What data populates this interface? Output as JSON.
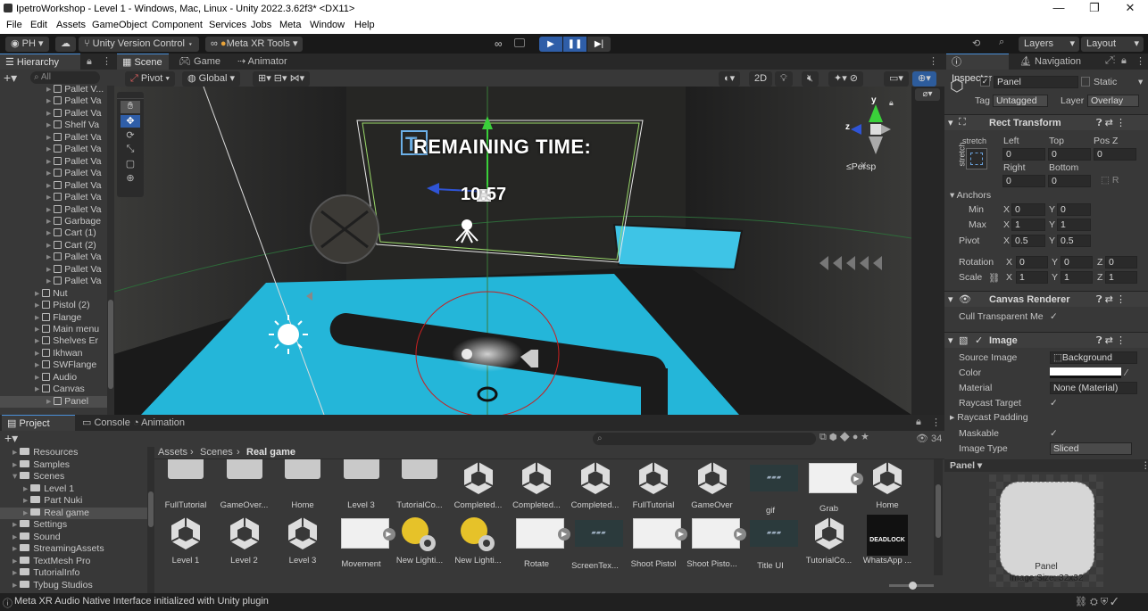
{
  "window": {
    "title": "IpetroWorkshop - Level 1 - Windows, Mac, Linux - Unity 2022.3.62f3* <DX11>",
    "min": "—",
    "max": "❐",
    "close": "✕"
  },
  "menu": [
    "File",
    "Edit",
    "Assets",
    "GameObject",
    "Component",
    "Services",
    "Jobs",
    "Meta",
    "Window",
    "Help"
  ],
  "toolbar": {
    "account": "PH ▾",
    "cloud": "☁",
    "vcs": "Unity Version Control ▾",
    "metaxr": "Meta XR Tools ▾",
    "layers": "Layers",
    "layout": "Layout"
  },
  "hierarchy": {
    "title": "Hierarchy",
    "search": "All",
    "items": [
      {
        "label": "Pallet V...",
        "indent": 4
      },
      {
        "label": "Pallet Va",
        "indent": 4
      },
      {
        "label": "Pallet Va",
        "indent": 4
      },
      {
        "label": "Shelf Va",
        "indent": 4
      },
      {
        "label": "Pallet Va",
        "indent": 4
      },
      {
        "label": "Pallet Va",
        "indent": 4
      },
      {
        "label": "Pallet Va",
        "indent": 4
      },
      {
        "label": "Pallet Va",
        "indent": 4
      },
      {
        "label": "Pallet Va",
        "indent": 4
      },
      {
        "label": "Pallet Va",
        "indent": 4
      },
      {
        "label": "Pallet Va",
        "indent": 4
      },
      {
        "label": "Garbage",
        "indent": 4
      },
      {
        "label": "Cart (1)",
        "indent": 4
      },
      {
        "label": "Cart (2)",
        "indent": 4
      },
      {
        "label": "Pallet Va",
        "indent": 4
      },
      {
        "label": "Pallet Va",
        "indent": 4
      },
      {
        "label": "Pallet Va",
        "indent": 4
      },
      {
        "label": "Nut",
        "indent": 3
      },
      {
        "label": "Pistol (2)",
        "indent": 3
      },
      {
        "label": "Flange",
        "indent": 3
      },
      {
        "label": "Main menu",
        "indent": 3
      },
      {
        "label": "Shelves Er",
        "indent": 3
      },
      {
        "label": "Ikhwan",
        "indent": 3
      },
      {
        "label": "SWFlange",
        "indent": 3
      },
      {
        "label": "Audio",
        "indent": 3
      },
      {
        "label": "Canvas",
        "indent": 3
      },
      {
        "label": "Panel",
        "indent": 4
      }
    ]
  },
  "scene": {
    "tabs": [
      "Scene",
      "Game",
      "Animator"
    ],
    "pivot": "Pivot ▾",
    "global": "Global ▾",
    "mode2d": "2D",
    "persp": "≤Persp",
    "hud_title": "REMAINING TIME:",
    "hud_time": "10:57",
    "axis_y": "y",
    "axis_z": "z"
  },
  "inspector": {
    "tabs": [
      "Inspector",
      "Navigation"
    ],
    "object": "Panel",
    "static": "Static",
    "tag_label": "Tag",
    "tag": "Untagged",
    "layer_label": "Layer",
    "layer": "Overlay",
    "rect": {
      "title": "Rect Transform",
      "stretch": "stretch",
      "left": "Left",
      "top": "Top",
      "posz": "Pos Z",
      "v_left": "0",
      "v_top": "0",
      "v_posz": "0",
      "right": "Right",
      "bottom": "Bottom",
      "v_right": "0",
      "v_bottom": "0",
      "anchors": "Anchors",
      "min": "Min",
      "max": "Max",
      "pivot": "Pivot",
      "min_x": "0",
      "min_y": "0",
      "max_x": "1",
      "max_y": "1",
      "piv_x": "0.5",
      "piv_y": "0.5",
      "rotation": "Rotation",
      "rx": "0",
      "ry": "0",
      "rz": "0",
      "scale": "Scale",
      "sx": "1",
      "sy": "1",
      "sz": "1"
    },
    "canvas_renderer": {
      "title": "Canvas Renderer",
      "cull": "Cull Transparent Me"
    },
    "image": {
      "title": "Image",
      "source_label": "Source Image",
      "source": "Background",
      "color_label": "Color",
      "material_label": "Material",
      "material": "None (Material)",
      "raycast_target": "Raycast Target",
      "raycast_padding": "Raycast Padding",
      "maskable": "Maskable",
      "image_type_label": "Image Type",
      "image_type": "Sliced"
    },
    "preview": {
      "title": "Panel ▾",
      "label": "Panel",
      "size": "Image Size: 32x32"
    }
  },
  "project": {
    "tabs": [
      "Project",
      "Console",
      "Animation"
    ],
    "count": "34",
    "breadcrumb": [
      "Assets",
      "Scenes",
      "Real game"
    ],
    "tree": [
      {
        "label": "Resources",
        "indent": 1
      },
      {
        "label": "Samples",
        "indent": 1
      },
      {
        "label": "Scenes",
        "indent": 1
      },
      {
        "label": "Level 1",
        "indent": 2
      },
      {
        "label": "Part Nuki",
        "indent": 2
      },
      {
        "label": "Real game",
        "indent": 2
      },
      {
        "label": "Settings",
        "indent": 1
      },
      {
        "label": "Sound",
        "indent": 1
      },
      {
        "label": "StreamingAssets",
        "indent": 1
      },
      {
        "label": "TextMesh Pro",
        "indent": 1
      },
      {
        "label": "TutorialInfo",
        "indent": 1
      },
      {
        "label": "Tybug Studios",
        "indent": 1
      }
    ],
    "row1": [
      "FullTutorial",
      "GameOver...",
      "Home",
      "Level 3",
      "TutorialCo...",
      "Completed...",
      "Completed...",
      "Completed...",
      "FullTutorial",
      "GameOver",
      "gif",
      "Grab",
      "Home"
    ],
    "row2": [
      "Level 1",
      "Level 2",
      "Level 3",
      "Movement",
      "New Lighti...",
      "New Lighti...",
      "Rotate",
      "ScreenTex...",
      "Shoot Pistol",
      "Shoot Pisto...",
      "Title UI",
      "TutorialCo...",
      "WhatsApp ..."
    ]
  },
  "status": {
    "message": "Meta XR Audio Native Interface initialized with Unity plugin"
  }
}
